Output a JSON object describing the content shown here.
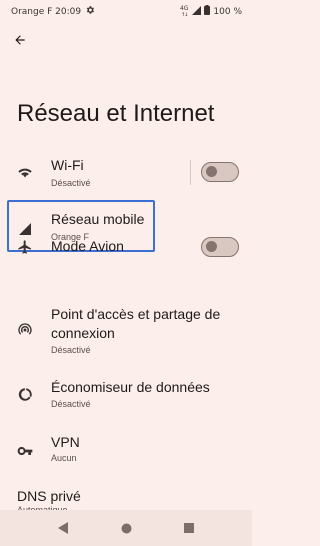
{
  "status": {
    "carrier_time": "Orange F 20:09",
    "network_type": "4G",
    "battery": "100 %"
  },
  "page": {
    "title": "Réseau et Internet"
  },
  "items": {
    "wifi": {
      "title": "Wi-Fi",
      "subtitle": "Désactivé",
      "toggle_on": false
    },
    "mobile": {
      "title": "Réseau mobile",
      "subtitle": "Orange F"
    },
    "airplane": {
      "title": "Mode Avion",
      "toggle_on": false
    },
    "hotspot": {
      "title_line1": "Point d'accès et partage de",
      "title_line2": "connexion",
      "subtitle": "Désactivé"
    },
    "datasaver": {
      "title": "Économiseur de données",
      "subtitle": "Désactivé"
    },
    "vpn": {
      "title": "VPN",
      "subtitle": "Aucun"
    },
    "dns": {
      "title": "DNS privé",
      "subtitle": "Automatique"
    }
  },
  "icons": {
    "back": "arrow-left-icon",
    "settings": "gear-icon",
    "wifi": "wifi-icon",
    "mobile": "cellular-signal-icon",
    "airplane": "airplane-icon",
    "hotspot": "hotspot-icon",
    "datasaver": "data-saver-icon",
    "vpn": "vpn-key-icon"
  },
  "colors": {
    "background": "#fcefeb",
    "highlight": "#3b6fd4",
    "toggle_off": "#857370"
  }
}
